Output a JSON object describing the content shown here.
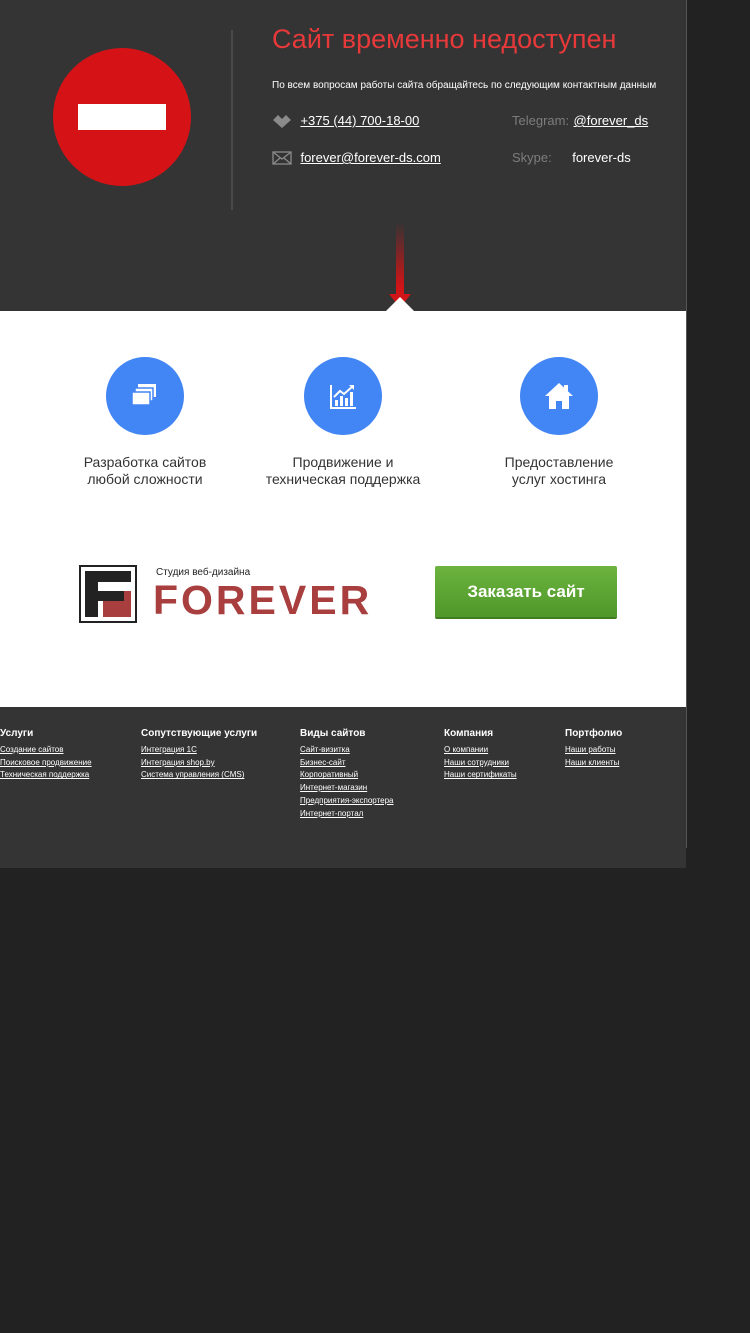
{
  "header": {
    "title": "Сайт временно недоступен",
    "subtitle": "По всем вопросам работы сайта обращайтесь по следующим контактным данным",
    "phone": "+375 (44) 700-18-00",
    "email": "forever@forever-ds.com",
    "telegram_label": "Telegram:",
    "telegram_value": "@forever_ds",
    "skype_label": "Skype:",
    "skype_value": "forever-ds",
    "title_color": "#e8393a",
    "stop_sign_color": "#d51317"
  },
  "services": [
    {
      "icon": "windows-stack-icon",
      "label": "Разработка сайтов\nлюбой сложности"
    },
    {
      "icon": "growth-chart-icon",
      "label": "Продвижение и\nтехническая поддержка"
    },
    {
      "icon": "house-icon",
      "label": "Предоставление\nуслуг хостинга"
    }
  ],
  "logo": {
    "subtitle": "Студия веб-дизайна",
    "name": "FOREVER",
    "color": "#a83e3e"
  },
  "order_button": {
    "label": "Заказать сайт",
    "color": "#5aa532"
  },
  "footer": {
    "columns": [
      {
        "title": "Услуги",
        "links": [
          "Создание сайтов",
          "Поисковое продвижение",
          "Техническая поддержка"
        ]
      },
      {
        "title": "Сопутствующие услуги",
        "links": [
          "Интеграция 1С",
          "Интеграция shop.by",
          "Система управления (CMS)"
        ]
      },
      {
        "title": "Виды сайтов",
        "links": [
          "Сайт-визитка",
          "Бизнес-сайт",
          "Корпоративный",
          "Интернет-магазин",
          "Предприятия-экспортера",
          "Интернет-портал"
        ]
      },
      {
        "title": "Компания",
        "links": [
          "О компании",
          "Наши сотрудники",
          "Наши сертификаты"
        ]
      },
      {
        "title": "Портфолио",
        "links": [
          "Наши работы",
          "Наши клиенты"
        ]
      }
    ]
  },
  "accent_blue": "#4285f4"
}
